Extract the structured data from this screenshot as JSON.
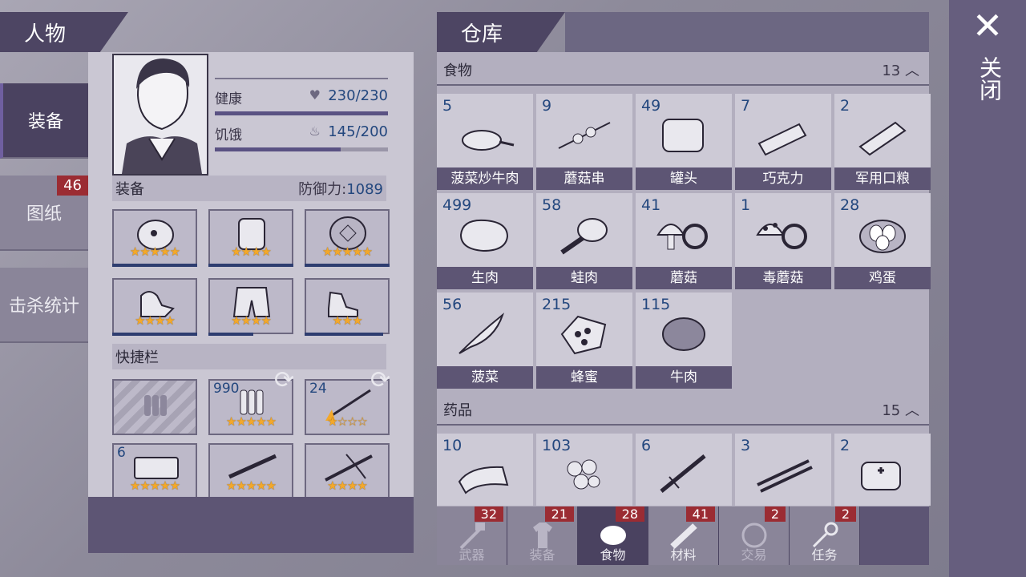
{
  "character": {
    "title": "人物",
    "tabs": [
      {
        "label": "装备"
      },
      {
        "label": "图纸",
        "badge": "46"
      },
      {
        "label": "击杀统计"
      }
    ],
    "stats": {
      "health_label": "健康",
      "health_value": "230/230",
      "health_fraction": 1.0,
      "hunger_label": "饥饿",
      "hunger_value": "145/200",
      "hunger_fraction": 0.725
    },
    "equipment": {
      "label": "装备",
      "defense_label": "防御力:",
      "defense_value": "1089"
    },
    "equip_slots": [
      {
        "icon": "helmet-icon",
        "stars": "★★★★★"
      },
      {
        "icon": "armor-vest-icon",
        "stars": "★★★★"
      },
      {
        "icon": "turtle-shell-icon",
        "stars": "★★★★★"
      },
      {
        "icon": "gloves-icon",
        "stars": "★★★★"
      },
      {
        "icon": "pants-icon",
        "stars": "★★★★"
      },
      {
        "icon": "shoes-icon",
        "stars": "★★★"
      }
    ],
    "quickbar": {
      "label": "快捷栏"
    },
    "quick_slots": [
      {
        "icon": "ammo-placeholder-icon",
        "qty": "",
        "stars": ""
      },
      {
        "icon": "bullets-icon",
        "qty": "990",
        "stars": "★★★★★"
      },
      {
        "icon": "spear-icon",
        "qty": "24",
        "stars": "★☆☆☆"
      },
      {
        "icon": "brick-icon",
        "qty": "6",
        "stars": "★★★★★"
      },
      {
        "icon": "shotgun-icon",
        "qty": "",
        "stars": "★★★★★"
      },
      {
        "icon": "crossbow-icon",
        "qty": "",
        "stars": "★★★★"
      }
    ]
  },
  "warehouse": {
    "title": "仓库",
    "food": {
      "label": "食物",
      "count": "13",
      "items": [
        {
          "qty": "5",
          "name": "菠菜炒牛肉",
          "icon": "pan-dish-icon"
        },
        {
          "qty": "9",
          "name": "蘑菇串",
          "icon": "skewer-icon"
        },
        {
          "qty": "49",
          "name": "罐头",
          "icon": "can-icon"
        },
        {
          "qty": "7",
          "name": "巧克力",
          "icon": "chocolate-icon"
        },
        {
          "qty": "2",
          "name": "军用口粮",
          "icon": "ration-icon"
        },
        {
          "qty": "499",
          "name": "生肉",
          "icon": "raw-meat-icon"
        },
        {
          "qty": "58",
          "name": "蛙肉",
          "icon": "frog-leg-icon"
        },
        {
          "qty": "41",
          "name": "蘑菇",
          "icon": "mushroom-icon"
        },
        {
          "qty": "1",
          "name": "毒蘑菇",
          "icon": "poison-mushroom-icon"
        },
        {
          "qty": "28",
          "name": "鸡蛋",
          "icon": "eggs-icon"
        },
        {
          "qty": "56",
          "name": "菠菜",
          "icon": "spinach-icon"
        },
        {
          "qty": "215",
          "name": "蜂蜜",
          "icon": "honeycomb-icon"
        },
        {
          "qty": "115",
          "name": "牛肉",
          "icon": "beef-icon"
        }
      ]
    },
    "medicine": {
      "label": "药品",
      "count": "15",
      "items": [
        {
          "qty": "10",
          "icon": "bandage-icon"
        },
        {
          "qty": "103",
          "icon": "herb-icon"
        },
        {
          "qty": "6",
          "icon": "syringe-icon"
        },
        {
          "qty": "3",
          "icon": "splint-icon"
        },
        {
          "qty": "2",
          "icon": "first-aid-kit-icon"
        }
      ]
    },
    "bottom_tabs": [
      {
        "label": "武器",
        "badge": "32",
        "icon": "axe-icon"
      },
      {
        "label": "装备",
        "badge": "21",
        "icon": "shirt-icon"
      },
      {
        "label": "食物",
        "badge": "28",
        "icon": "meat-icon"
      },
      {
        "label": "材料",
        "badge": "41",
        "icon": "log-icon"
      },
      {
        "label": "交易",
        "badge": "2",
        "icon": "coin-icon"
      },
      {
        "label": "任务",
        "badge": "2",
        "icon": "key-icon"
      }
    ]
  },
  "close": {
    "label": "关闭",
    "icon": "close-icon"
  }
}
